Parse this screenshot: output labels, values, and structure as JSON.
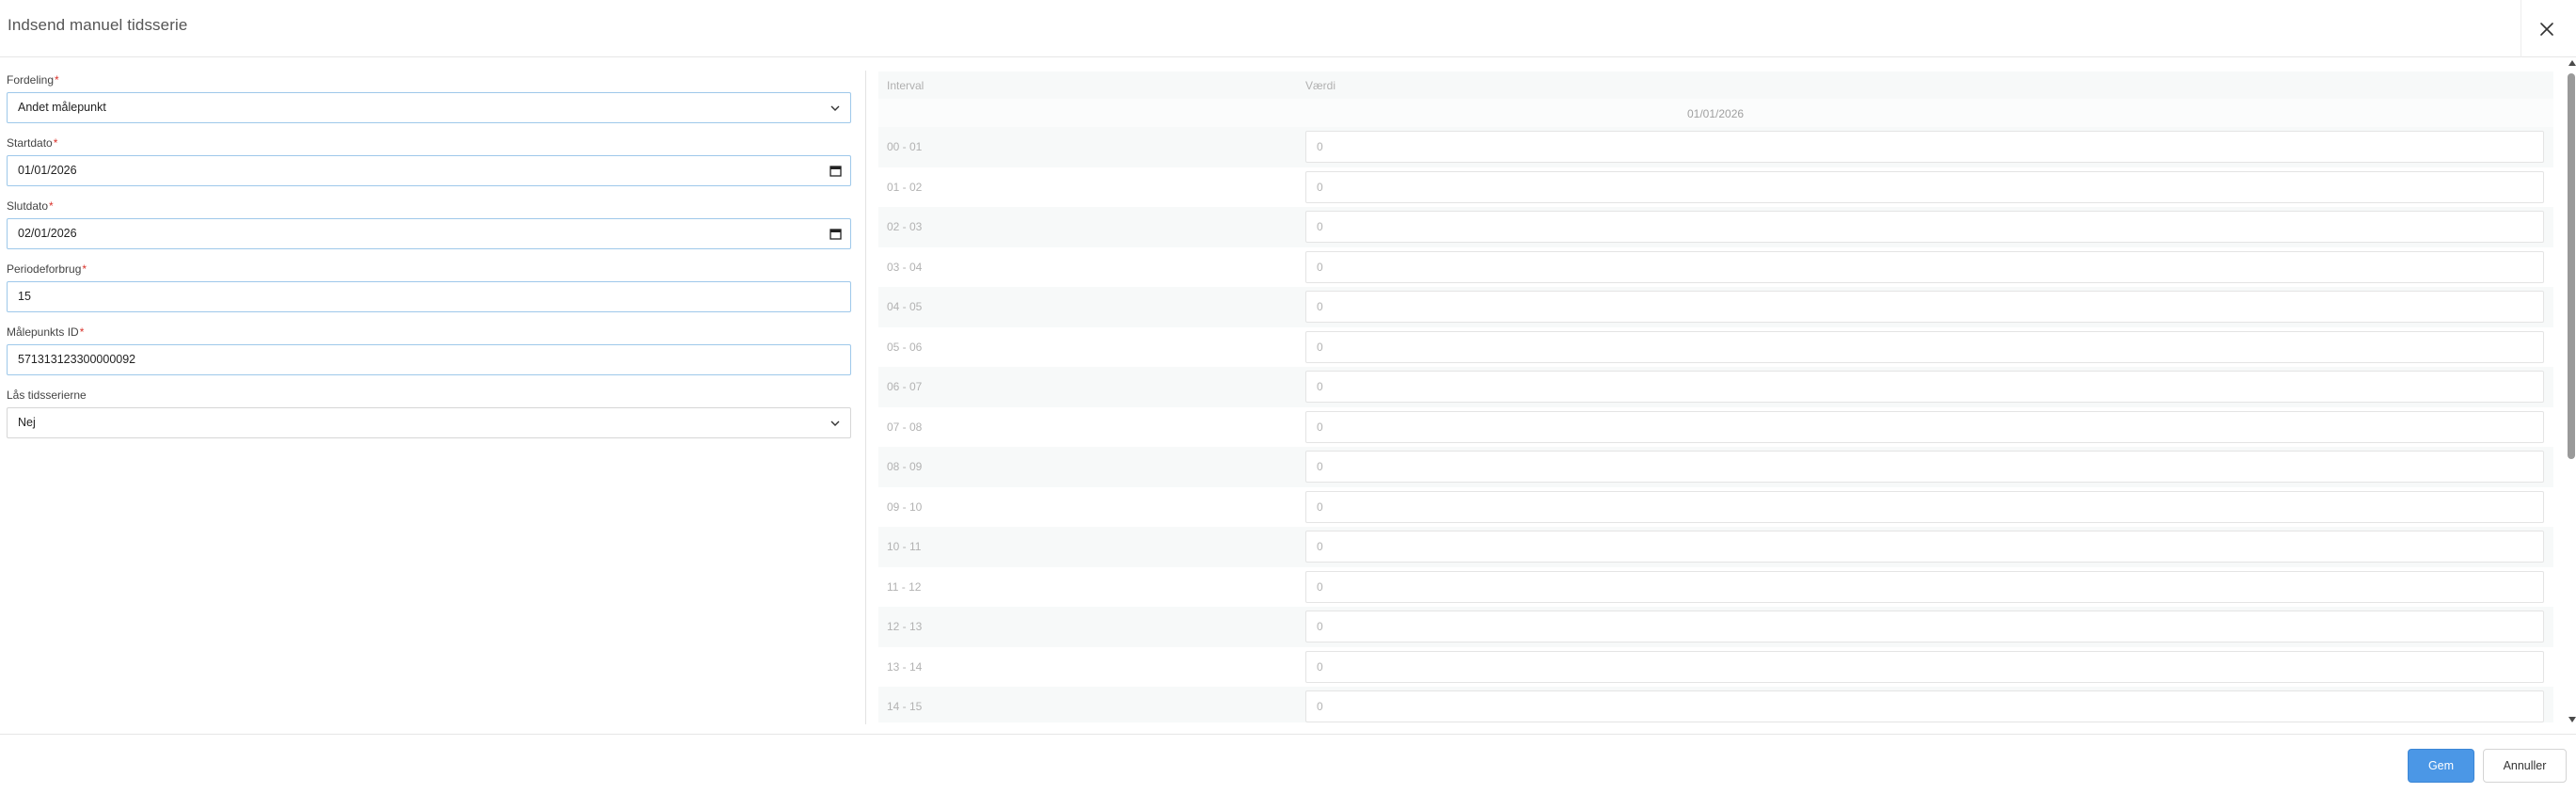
{
  "dialog": {
    "title": "Indsend manuel tidsserie"
  },
  "form": {
    "fordeling": {
      "label": "Fordeling",
      "value": "Andet målepunkt"
    },
    "startdato": {
      "label": "Startdato",
      "value": "01/01/2026"
    },
    "slutdato": {
      "label": "Slutdato",
      "value": "02/01/2026"
    },
    "periodeforbrug": {
      "label": "Periodeforbrug",
      "value": "15"
    },
    "maalepunkt": {
      "label": "Målepunkts ID",
      "value": "571313123300000092"
    },
    "laas": {
      "label": "Lås tidsserierne",
      "value": "Nej"
    },
    "required_mark": "*"
  },
  "table": {
    "col_interval": "Interval",
    "col_vaerdi": "Værdi",
    "date_header": "01/01/2026",
    "rows": [
      {
        "interval": "00 - 01",
        "value": "0"
      },
      {
        "interval": "01 - 02",
        "value": "0"
      },
      {
        "interval": "02 - 03",
        "value": "0"
      },
      {
        "interval": "03 - 04",
        "value": "0"
      },
      {
        "interval": "04 - 05",
        "value": "0"
      },
      {
        "interval": "05 - 06",
        "value": "0"
      },
      {
        "interval": "06 - 07",
        "value": "0"
      },
      {
        "interval": "07 - 08",
        "value": "0"
      },
      {
        "interval": "08 - 09",
        "value": "0"
      },
      {
        "interval": "09 - 10",
        "value": "0"
      },
      {
        "interval": "10 - 11",
        "value": "0"
      },
      {
        "interval": "11 - 12",
        "value": "0"
      },
      {
        "interval": "12 - 13",
        "value": "0"
      },
      {
        "interval": "13 - 14",
        "value": "0"
      },
      {
        "interval": "14 - 15",
        "value": "0"
      }
    ]
  },
  "footer": {
    "save_label": "Gem",
    "cancel_label": "Annuller"
  },
  "colors": {
    "primary": "#4b97e6",
    "required": "#d9322b",
    "input_border_active": "#9ec8ea"
  }
}
